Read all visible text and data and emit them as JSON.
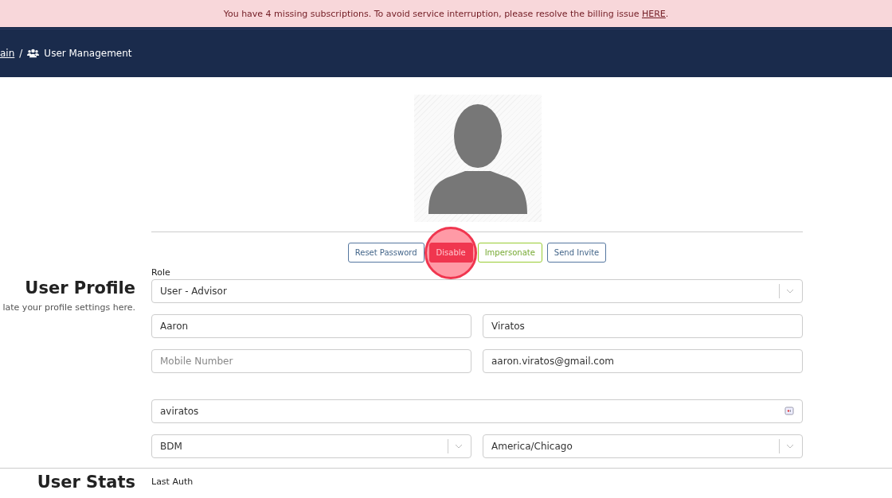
{
  "banner": {
    "text": "You have 4 missing subscriptions. To avoid service interruption, please resolve the billing issue ",
    "link": "HERE",
    "end": "."
  },
  "breadcrumb": {
    "parent": "ain",
    "separator": "/",
    "current": "User Management"
  },
  "profile": {
    "title": "User Profile",
    "subtitle": "late your profile settings here."
  },
  "actions": [
    {
      "label": "Reset Password",
      "kind": "outline-blue"
    },
    {
      "label": "Disable",
      "kind": "danger"
    },
    {
      "label": "Impersonate",
      "kind": "outline-green"
    },
    {
      "label": "Send Invite",
      "kind": "outline-blue"
    }
  ],
  "role": {
    "label": "Role",
    "value": "User - Advisor"
  },
  "rows": [
    [
      {
        "kind": "input",
        "value": "Aaron"
      },
      {
        "kind": "input",
        "value": "Viratos"
      }
    ],
    [
      {
        "kind": "input",
        "placeholder": "Mobile Number"
      },
      {
        "kind": "input",
        "value": "aaron.viratos@gmail.com"
      }
    ],
    [
      {
        "kind": "password",
        "value": "aviratos"
      }
    ],
    [
      {
        "kind": "select",
        "value": "BDM"
      },
      {
        "kind": "select",
        "value": "America/Chicago"
      }
    ]
  ],
  "stats": {
    "title": "User Stats",
    "label": "Last Auth"
  }
}
